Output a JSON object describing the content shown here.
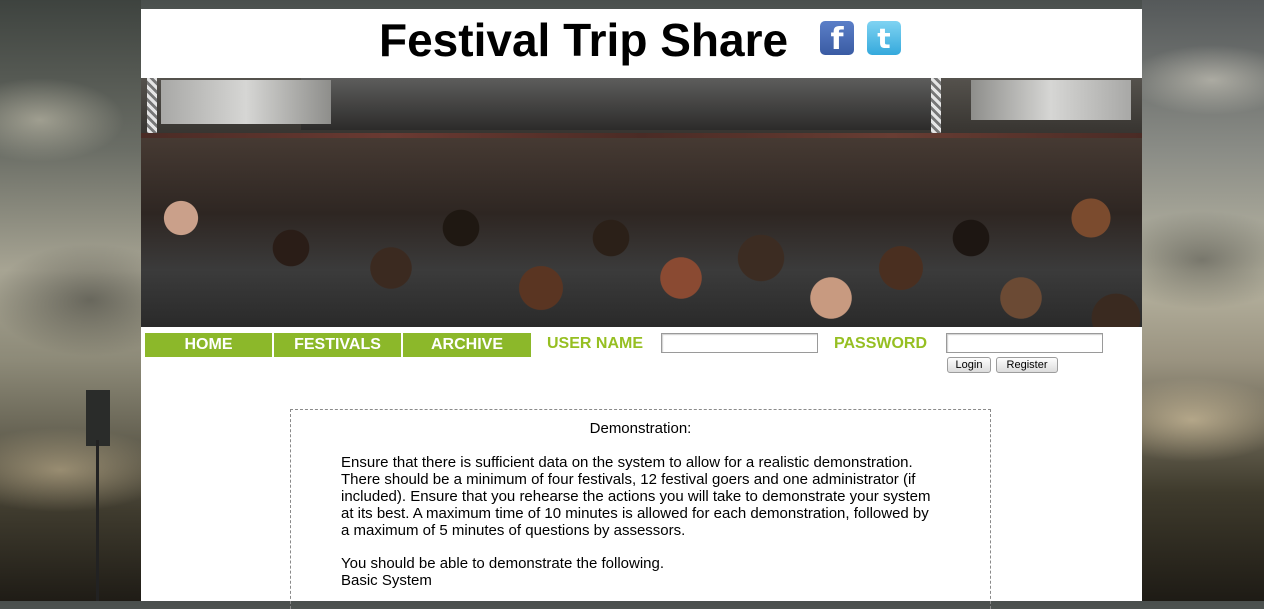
{
  "header": {
    "title": "Festival Trip Share",
    "facebook_icon": "facebook-icon",
    "twitter_icon": "twitter-icon",
    "facebook_glyph": "f",
    "twitter_glyph": "t"
  },
  "nav": {
    "items": [
      {
        "label": "HOME"
      },
      {
        "label": "FESTIVALS"
      },
      {
        "label": "ARCHIVE"
      }
    ]
  },
  "login": {
    "username_label": "USER NAME",
    "password_label": "PASSWORD",
    "username_value": "",
    "password_value": "",
    "login_button": "Login",
    "register_button": "Register"
  },
  "demo": {
    "title": "Demonstration:",
    "paragraph1": "Ensure that there is sufficient data on the system to allow for a realistic demonstration. There should be a minimum of four festivals, 12 festival goers and one administrator (if included). Ensure that you rehearse the actions you will take to demonstrate your system at its best. A maximum time of 10 minutes is allowed for each demonstration, followed by a maximum of 5 minutes of questions by assessors.",
    "paragraph2": "You should be able to demonstrate the following.",
    "paragraph3": "Basic System"
  },
  "colors": {
    "nav_green": "#8cb82a",
    "label_green": "#96bf22",
    "facebook_blue": "#3b5998",
    "twitter_blue": "#33ccff"
  }
}
